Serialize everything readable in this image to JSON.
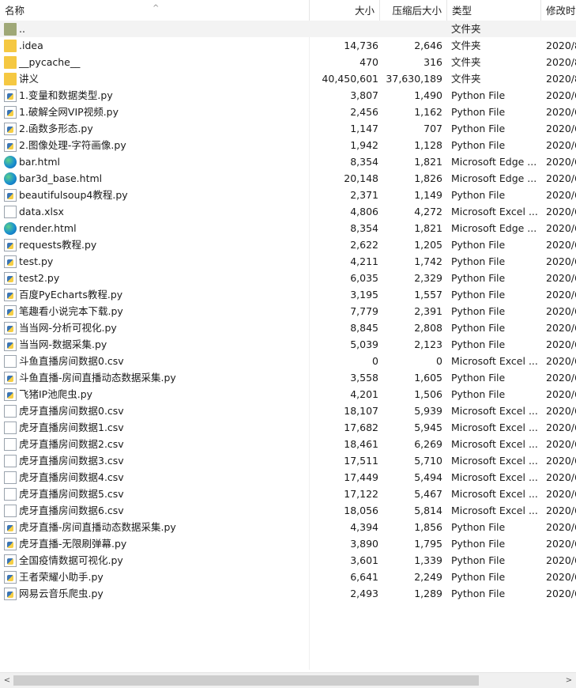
{
  "columns": {
    "name": "名称",
    "size": "大小",
    "compressed": "压缩后大小",
    "type": "类型",
    "modified": "修改时"
  },
  "files": [
    {
      "icon": "folder-up",
      "name": "..",
      "size": "",
      "comp": "",
      "type": "文件夹",
      "date": ""
    },
    {
      "icon": "folder",
      "name": ".idea",
      "size": "14,736",
      "comp": "2,646",
      "type": "文件夹",
      "date": "2020/8"
    },
    {
      "icon": "folder",
      "name": "__pycache__",
      "size": "470",
      "comp": "316",
      "type": "文件夹",
      "date": "2020/8"
    },
    {
      "icon": "folder",
      "name": "讲义",
      "size": "40,450,601",
      "comp": "37,630,189",
      "type": "文件夹",
      "date": "2020/8"
    },
    {
      "icon": "py",
      "name": "1.变量和数据类型.py",
      "size": "3,807",
      "comp": "1,490",
      "type": "Python File",
      "date": "2020/6"
    },
    {
      "icon": "py",
      "name": "1.破解全网VIP视频.py",
      "size": "2,456",
      "comp": "1,162",
      "type": "Python File",
      "date": "2020/6"
    },
    {
      "icon": "py",
      "name": "2.函数多形态.py",
      "size": "1,147",
      "comp": "707",
      "type": "Python File",
      "date": "2020/6"
    },
    {
      "icon": "py",
      "name": "2.图像处理-字符画像.py",
      "size": "1,942",
      "comp": "1,128",
      "type": "Python File",
      "date": "2020/6"
    },
    {
      "icon": "edge",
      "name": "bar.html",
      "size": "8,354",
      "comp": "1,821",
      "type": "Microsoft Edge ...",
      "date": "2020/6"
    },
    {
      "icon": "edge",
      "name": "bar3d_base.html",
      "size": "20,148",
      "comp": "1,826",
      "type": "Microsoft Edge ...",
      "date": "2020/6"
    },
    {
      "icon": "py",
      "name": "beautifulsoup4教程.py",
      "size": "2,371",
      "comp": "1,149",
      "type": "Python File",
      "date": "2020/6"
    },
    {
      "icon": "doc",
      "name": "data.xlsx",
      "size": "4,806",
      "comp": "4,272",
      "type": "Microsoft Excel ...",
      "date": "2020/6"
    },
    {
      "icon": "edge",
      "name": "render.html",
      "size": "8,354",
      "comp": "1,821",
      "type": "Microsoft Edge ...",
      "date": "2020/6"
    },
    {
      "icon": "py",
      "name": "requests教程.py",
      "size": "2,622",
      "comp": "1,205",
      "type": "Python File",
      "date": "2020/6"
    },
    {
      "icon": "py",
      "name": "test.py",
      "size": "4,211",
      "comp": "1,742",
      "type": "Python File",
      "date": "2020/6"
    },
    {
      "icon": "py",
      "name": "test2.py",
      "size": "6,035",
      "comp": "2,329",
      "type": "Python File",
      "date": "2020/6"
    },
    {
      "icon": "py",
      "name": "百度PyEcharts教程.py",
      "size": "3,195",
      "comp": "1,557",
      "type": "Python File",
      "date": "2020/6"
    },
    {
      "icon": "py",
      "name": "笔趣看小说完本下载.py",
      "size": "7,779",
      "comp": "2,391",
      "type": "Python File",
      "date": "2020/6"
    },
    {
      "icon": "py",
      "name": "当当网-分析可视化.py",
      "size": "8,845",
      "comp": "2,808",
      "type": "Python File",
      "date": "2020/6"
    },
    {
      "icon": "py",
      "name": "当当网-数据采集.py",
      "size": "5,039",
      "comp": "2,123",
      "type": "Python File",
      "date": "2020/6"
    },
    {
      "icon": "doc",
      "name": "斗鱼直播房间数据0.csv",
      "size": "0",
      "comp": "0",
      "type": "Microsoft Excel ...",
      "date": "2020/6"
    },
    {
      "icon": "py",
      "name": "斗鱼直播-房间直播动态数据采集.py",
      "size": "3,558",
      "comp": "1,605",
      "type": "Python File",
      "date": "2020/6"
    },
    {
      "icon": "py",
      "name": "飞猪IP池爬虫.py",
      "size": "4,201",
      "comp": "1,506",
      "type": "Python File",
      "date": "2020/6"
    },
    {
      "icon": "doc",
      "name": "虎牙直播房间数据0.csv",
      "size": "18,107",
      "comp": "5,939",
      "type": "Microsoft Excel ...",
      "date": "2020/6"
    },
    {
      "icon": "doc",
      "name": "虎牙直播房间数据1.csv",
      "size": "17,682",
      "comp": "5,945",
      "type": "Microsoft Excel ...",
      "date": "2020/6"
    },
    {
      "icon": "doc",
      "name": "虎牙直播房间数据2.csv",
      "size": "18,461",
      "comp": "6,269",
      "type": "Microsoft Excel ...",
      "date": "2020/6"
    },
    {
      "icon": "doc",
      "name": "虎牙直播房间数据3.csv",
      "size": "17,511",
      "comp": "5,710",
      "type": "Microsoft Excel ...",
      "date": "2020/6"
    },
    {
      "icon": "doc",
      "name": "虎牙直播房间数据4.csv",
      "size": "17,449",
      "comp": "5,494",
      "type": "Microsoft Excel ...",
      "date": "2020/6"
    },
    {
      "icon": "doc",
      "name": "虎牙直播房间数据5.csv",
      "size": "17,122",
      "comp": "5,467",
      "type": "Microsoft Excel ...",
      "date": "2020/6"
    },
    {
      "icon": "doc",
      "name": "虎牙直播房间数据6.csv",
      "size": "18,056",
      "comp": "5,814",
      "type": "Microsoft Excel ...",
      "date": "2020/6"
    },
    {
      "icon": "py",
      "name": "虎牙直播-房间直播动态数据采集.py",
      "size": "4,394",
      "comp": "1,856",
      "type": "Python File",
      "date": "2020/6"
    },
    {
      "icon": "py",
      "name": "虎牙直播-无限刷弹幕.py",
      "size": "3,890",
      "comp": "1,795",
      "type": "Python File",
      "date": "2020/6"
    },
    {
      "icon": "py",
      "name": "全国疫情数据可视化.py",
      "size": "3,601",
      "comp": "1,339",
      "type": "Python File",
      "date": "2020/6"
    },
    {
      "icon": "py",
      "name": "王者荣耀小助手.py",
      "size": "6,641",
      "comp": "2,249",
      "type": "Python File",
      "date": "2020/6"
    },
    {
      "icon": "py",
      "name": "网易云音乐爬虫.py",
      "size": "2,493",
      "comp": "1,289",
      "type": "Python File",
      "date": "2020/6"
    }
  ],
  "scrollbar": {
    "left_arrow": "<",
    "right_arrow": ">"
  }
}
